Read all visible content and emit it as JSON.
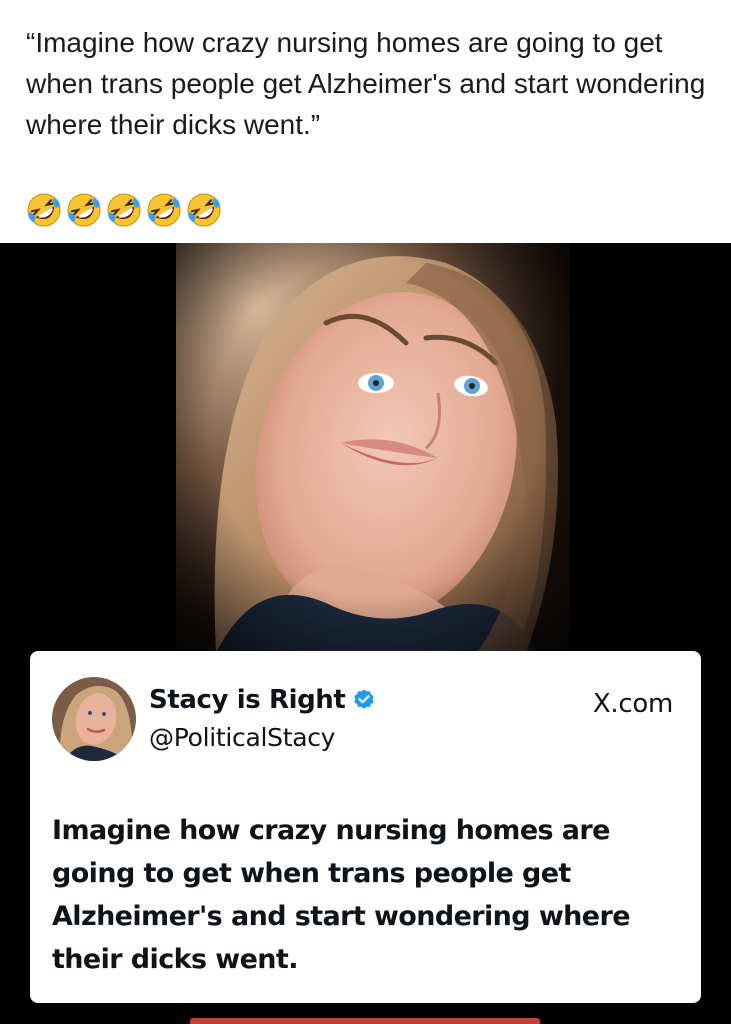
{
  "post": {
    "caption": "“Imagine how crazy nursing homes are going to get when trans people get Alzheimer's and start wondering where their dicks went.”",
    "emojis": [
      "rolling-on-floor-laughing-emoji",
      "rolling-on-floor-laughing-emoji",
      "rolling-on-floor-laughing-emoji",
      "rolling-on-floor-laughing-emoji",
      "rolling-on-floor-laughing-emoji"
    ]
  },
  "tweet": {
    "display_name": "Stacy is Right",
    "handle": "@PoliticalStacy",
    "source": "X.com",
    "verified_icon": "verified-badge-icon",
    "text": "Imagine how crazy nursing homes are going to get when trans people get Alzheimer's and start wondering where their dicks went."
  },
  "colors": {
    "verified_blue": "#1d9bf0",
    "media_background": "#000000",
    "card_background": "#ffffff"
  }
}
